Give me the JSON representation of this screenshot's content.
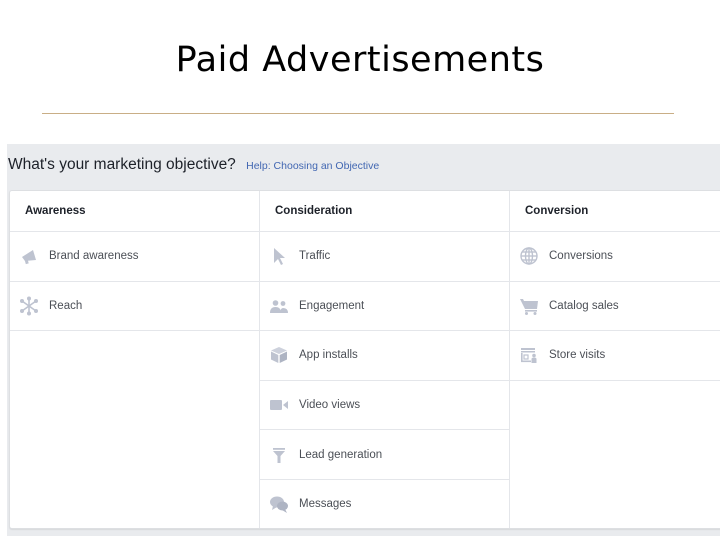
{
  "slide": {
    "title": "Paid Advertisements"
  },
  "objective": {
    "question": "What's your marketing objective?",
    "help_link": "Help: Choosing an Objective"
  },
  "columns": [
    {
      "header": "Awareness",
      "items": [
        {
          "label": "Brand awareness",
          "icon": "megaphone-icon"
        },
        {
          "label": "Reach",
          "icon": "reach-network-icon"
        }
      ]
    },
    {
      "header": "Consideration",
      "items": [
        {
          "label": "Traffic",
          "icon": "cursor-icon"
        },
        {
          "label": "Engagement",
          "icon": "people-icon"
        },
        {
          "label": "App installs",
          "icon": "box-icon"
        },
        {
          "label": "Video views",
          "icon": "video-camera-icon"
        },
        {
          "label": "Lead generation",
          "icon": "funnel-icon"
        },
        {
          "label": "Messages",
          "icon": "chat-bubbles-icon"
        }
      ]
    },
    {
      "header": "Conversion",
      "items": [
        {
          "label": "Conversions",
          "icon": "globe-icon"
        },
        {
          "label": "Catalog sales",
          "icon": "shopping-cart-icon"
        },
        {
          "label": "Store visits",
          "icon": "storefront-icon"
        }
      ]
    }
  ],
  "colors": {
    "icon": "#bec3d0",
    "link": "#4267b2",
    "accent_rule": "#c9ae86",
    "panel_bg": "#e9ebee"
  }
}
